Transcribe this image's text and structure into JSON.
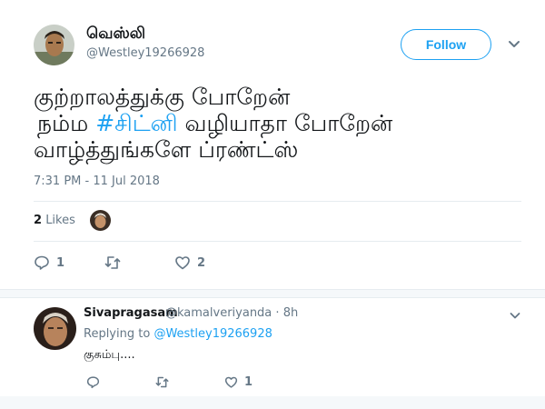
{
  "tweet": {
    "author_name": "வெஸ்லி",
    "author_handle": "@Westley19266928",
    "follow_label": "Follow",
    "text_lines": [
      {
        "before": "குற்றாலத்துக்கு போறேன்",
        "hashtag": "",
        "after": ""
      },
      {
        "before": " நம்ம ",
        "hashtag": "#சிட்னி",
        "after": " வழியாதா போறேன்"
      },
      {
        "before": "வாழ்த்துங்களே ப்ரண்ட்ஸ்",
        "hashtag": "",
        "after": ""
      }
    ],
    "timestamp": "7:31 PM - 11 Jul 2018",
    "likes_count": "2",
    "likes_label": "Likes",
    "actions": {
      "reply_count": "1",
      "retweet_count": "",
      "like_count": "2"
    }
  },
  "reply": {
    "author_name": "Sivapragasam",
    "author_handle": "@kamalveriyanda",
    "time": "8h",
    "replying_prefix": "Replying to",
    "replying_to": "@Westley19266928",
    "text": "குசும்பு....",
    "actions": {
      "reply_count": "",
      "retweet_count": "",
      "like_count": "1"
    }
  },
  "icons": {
    "reply": "reply-icon",
    "retweet": "retweet-icon",
    "like": "heart-icon",
    "caret": "chevron-down-icon"
  },
  "colors": {
    "accent": "#1da1f2",
    "secondary_text": "#657786",
    "divider": "#e6ecf0"
  }
}
